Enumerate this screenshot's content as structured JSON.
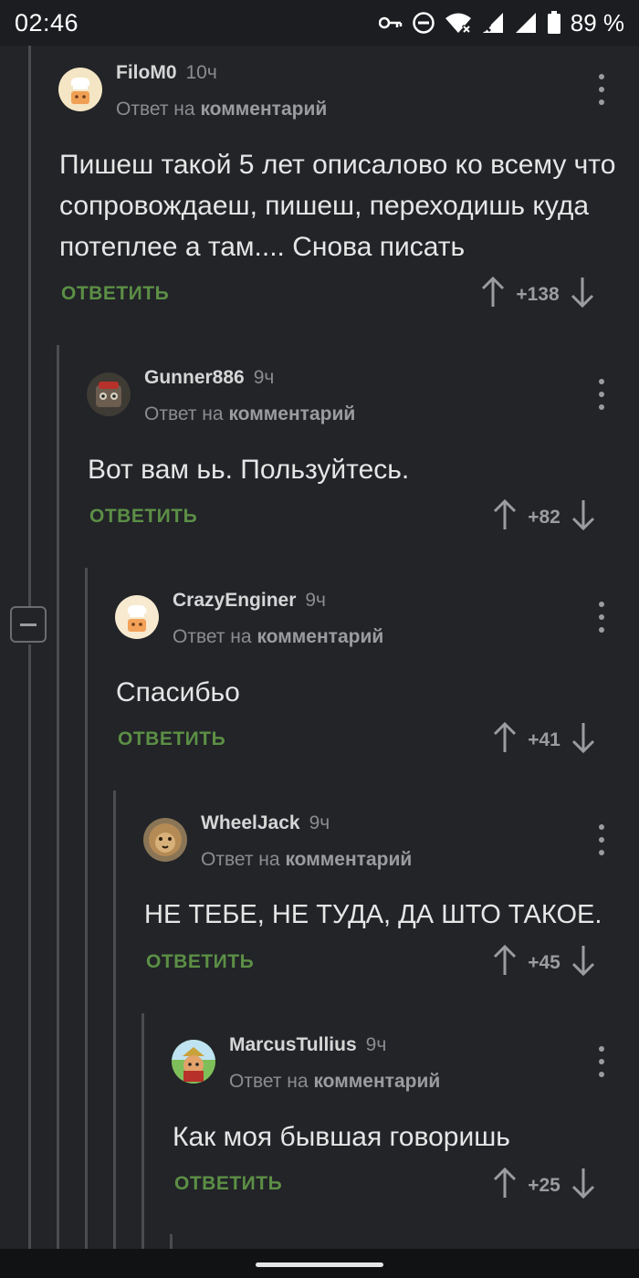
{
  "status": {
    "time": "02:46",
    "battery": "89 %"
  },
  "reply_prefix": "Ответ на",
  "reply_target": "комментарий",
  "reply_label": "ОТВЕТИТЬ",
  "comments": [
    {
      "username": "FiloM0",
      "time": "10ч",
      "text": "Пишеш такой 5 лет описалово ко всему что сопровождаеш, пишеш, переходишь куда потеплее а там.... Снова писать",
      "rating": "+138"
    },
    {
      "username": "Gunner886",
      "time": "9ч",
      "text": "Вот вам ьь. Пользуйтесь.",
      "rating": "+82"
    },
    {
      "username": "CrazyEnginer",
      "time": "9ч",
      "text": "Спасибьо",
      "rating": "+41"
    },
    {
      "username": "WheelJack",
      "time": "9ч",
      "text": "НЕ ТЕБЕ, НЕ ТУДА, ДА ШТО ТАКОЕ.",
      "rating": "+45"
    },
    {
      "username": "MarcusTullius",
      "time": "9ч",
      "text": "Как моя бывшая говоришь",
      "rating": "+25"
    }
  ]
}
